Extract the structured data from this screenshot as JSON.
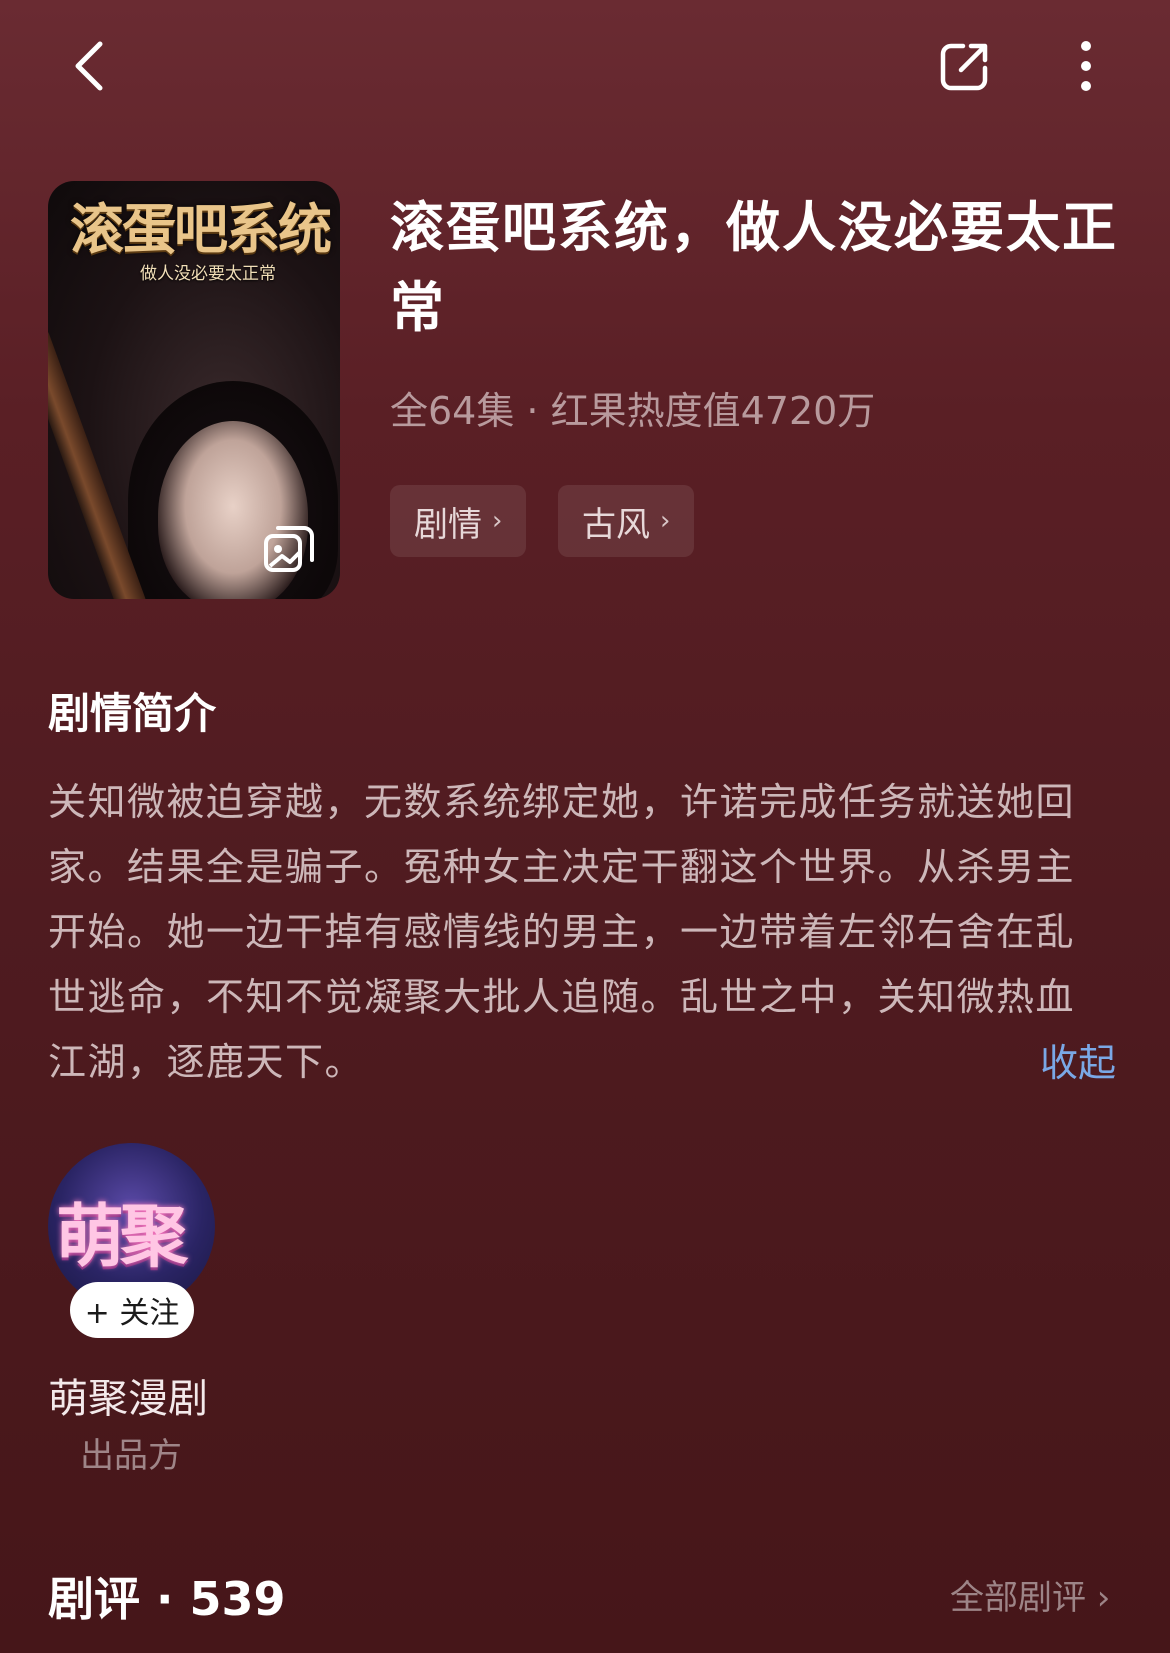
{
  "topbar": {
    "back_icon": "chevron-left-icon",
    "share_icon": "share-icon",
    "more_icon": "more-vertical-icon"
  },
  "cover": {
    "title": "滚蛋吧系统",
    "subtitle": "做人没必要太正常",
    "badge_icon": "gallery-icon"
  },
  "drama": {
    "title": "滚蛋吧系统，做人没必要太正常",
    "meta": "全64集 · 红果热度值4720万",
    "tags": [
      {
        "label": "剧情"
      },
      {
        "label": "古风"
      }
    ]
  },
  "synopsis": {
    "heading": "剧情简介",
    "text": "关知微被迫穿越，无数系统绑定她，许诺完成任务就送她回家。结果全是骗子。冤种女主决定干翻这个世界。从杀男主开始。她一边干掉有感情线的男主，一边带着左邻右舍在乱世逃命，不知不觉凝聚大批人追随。乱世之中，关知微热血江湖，逐鹿天下。",
    "collapse": "收起"
  },
  "studio": {
    "logo_text": "萌聚",
    "follow": "+ 关注",
    "name": "萌聚漫剧",
    "role": "出品方"
  },
  "reviews": {
    "heading": "剧评 · 539",
    "all": "全部剧评 ›"
  },
  "colors": {
    "background": "#5a1f25",
    "link": "#7aa8e6"
  }
}
